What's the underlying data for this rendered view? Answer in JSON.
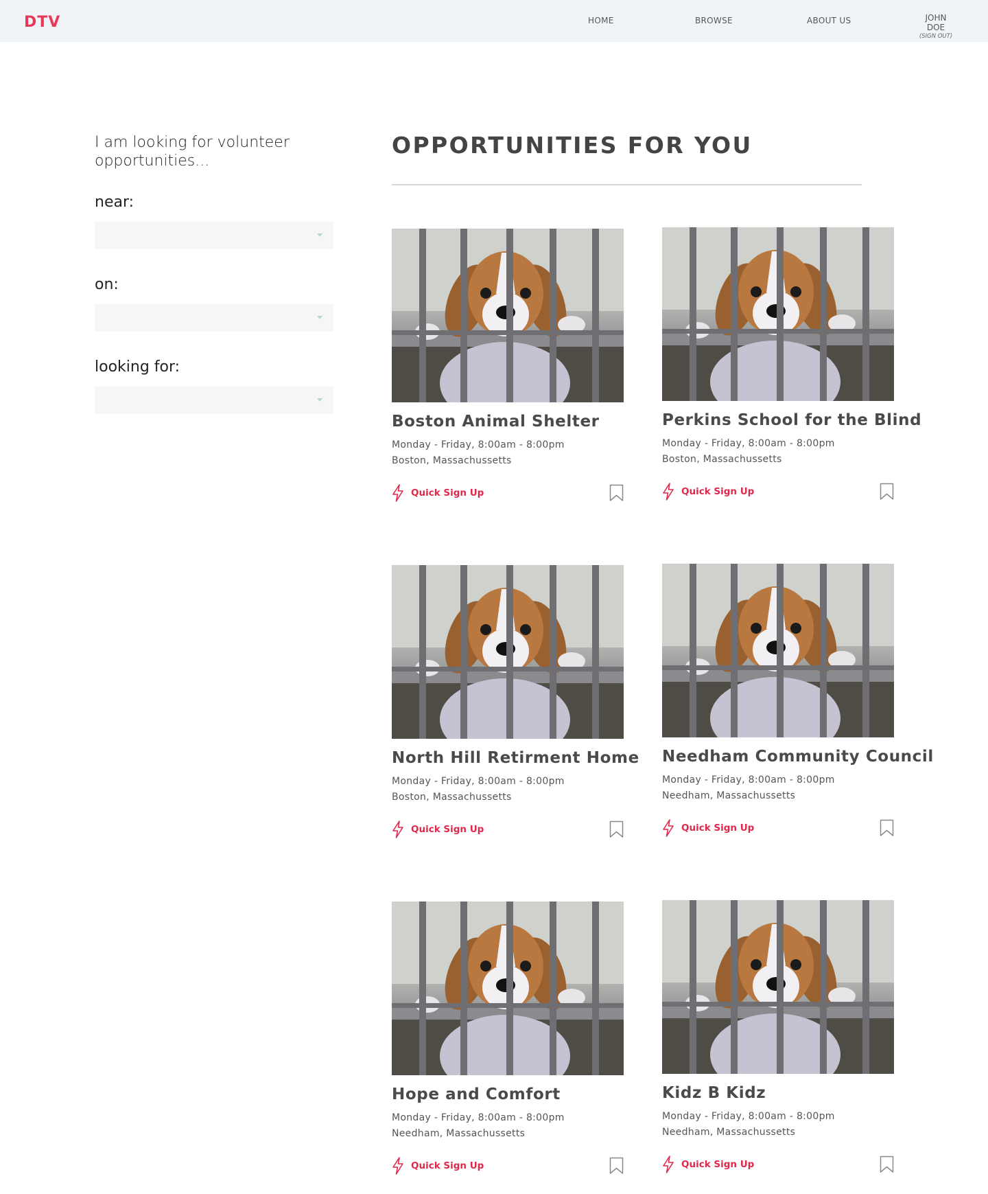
{
  "header": {
    "logo": "DTV",
    "nav": [
      {
        "label": "HOME"
      },
      {
        "label": "BROWSE"
      },
      {
        "label": "ABOUT US"
      }
    ],
    "user": {
      "name": "JOHN DOE",
      "sign_out": "(SIGN OUT)"
    }
  },
  "sidebar": {
    "intro": "I am looking for volunteer opportunities...",
    "filters": [
      {
        "label": "near:",
        "value": ""
      },
      {
        "label": "on:",
        "value": ""
      },
      {
        "label": "looking for:",
        "value": ""
      }
    ]
  },
  "main": {
    "title": "OPPORTUNITIES FOR YOU",
    "cards": [
      {
        "title": "Boston Animal Shelter",
        "schedule": "Monday - Friday, 8:00am - 8:00pm",
        "location": "Boston, Massachussetts",
        "action": "Quick Sign Up"
      },
      {
        "title": "Perkins School for the Blind",
        "schedule": "Monday - Friday, 8:00am - 8:00pm",
        "location": "Boston, Massachussetts",
        "action": "Quick Sign Up"
      },
      {
        "title": "North Hill Retirment Home",
        "schedule": "Monday - Friday, 8:00am - 8:00pm",
        "location": "Boston, Massachussetts",
        "action": "Quick Sign Up"
      },
      {
        "title": "Needham Community Council",
        "schedule": "Monday - Friday, 8:00am - 8:00pm",
        "location": "Needham, Massachussetts",
        "action": "Quick Sign Up"
      },
      {
        "title": "Hope and Comfort",
        "schedule": "Monday - Friday, 8:00am - 8:00pm",
        "location": "Needham, Massachussetts",
        "action": "Quick Sign Up"
      },
      {
        "title": "Kidz B Kidz",
        "schedule": "Monday - Friday, 8:00am - 8:00pm",
        "location": "Needham, Massachussetts",
        "action": "Quick Sign Up"
      }
    ]
  },
  "icons": {
    "quick_signup": "lightning-bolt-icon",
    "save": "bookmark-icon",
    "dropdown": "caret-down-icon"
  },
  "colors": {
    "brand": "#e8375a",
    "accent": "#e0284b",
    "header_bg": "#f1f4f7",
    "select_bg": "#f6f6f6"
  }
}
